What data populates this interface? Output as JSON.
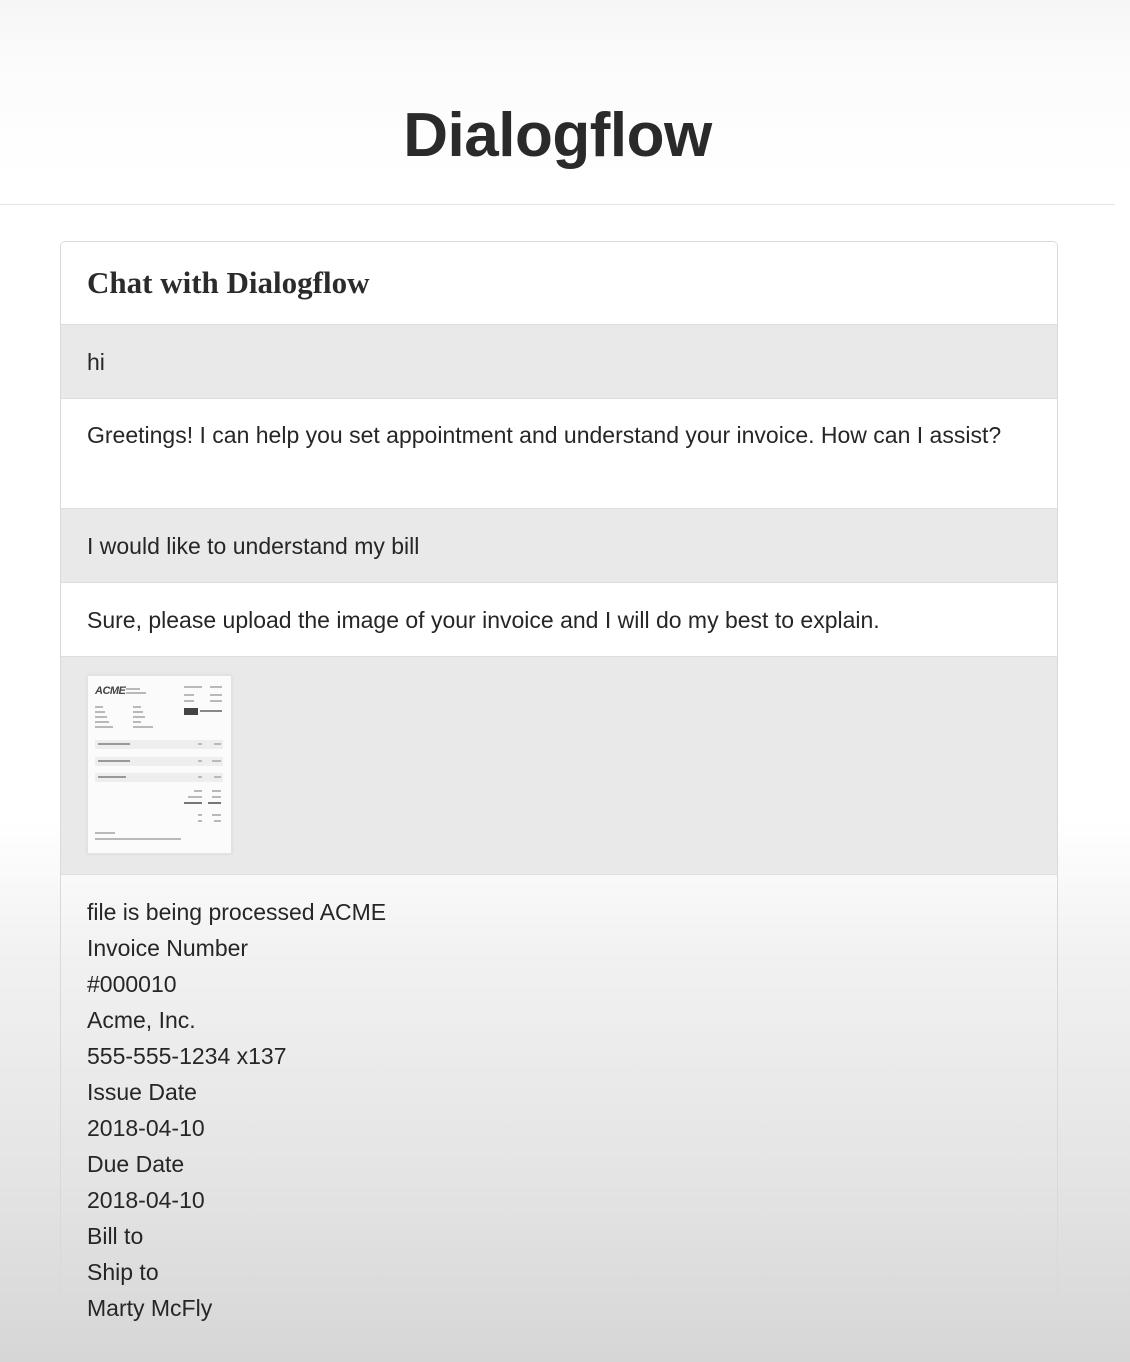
{
  "header": {
    "title": "Dialogflow"
  },
  "chat": {
    "title": "Chat with Dialogflow",
    "messages": [
      {
        "role": "user",
        "text": "hi"
      },
      {
        "role": "bot",
        "text": "Greetings! I can help you set appointment and understand your invoice. How can I assist?"
      },
      {
        "role": "user",
        "text": "I would like to understand my bill"
      },
      {
        "role": "bot",
        "text": "Sure, please upload the image of your invoice and I will do my best to explain."
      },
      {
        "role": "user",
        "type": "image",
        "thumbnail_logo": "ACME"
      },
      {
        "role": "bot",
        "lines": [
          "file is being processed ACME",
          "Invoice Number",
          "#000010",
          "Acme, Inc.",
          "555-555-1234 x137",
          "Issue Date",
          "2018-04-10",
          "Due Date",
          "2018-04-10",
          "Bill to",
          "Ship to",
          "Marty McFly"
        ]
      }
    ]
  }
}
